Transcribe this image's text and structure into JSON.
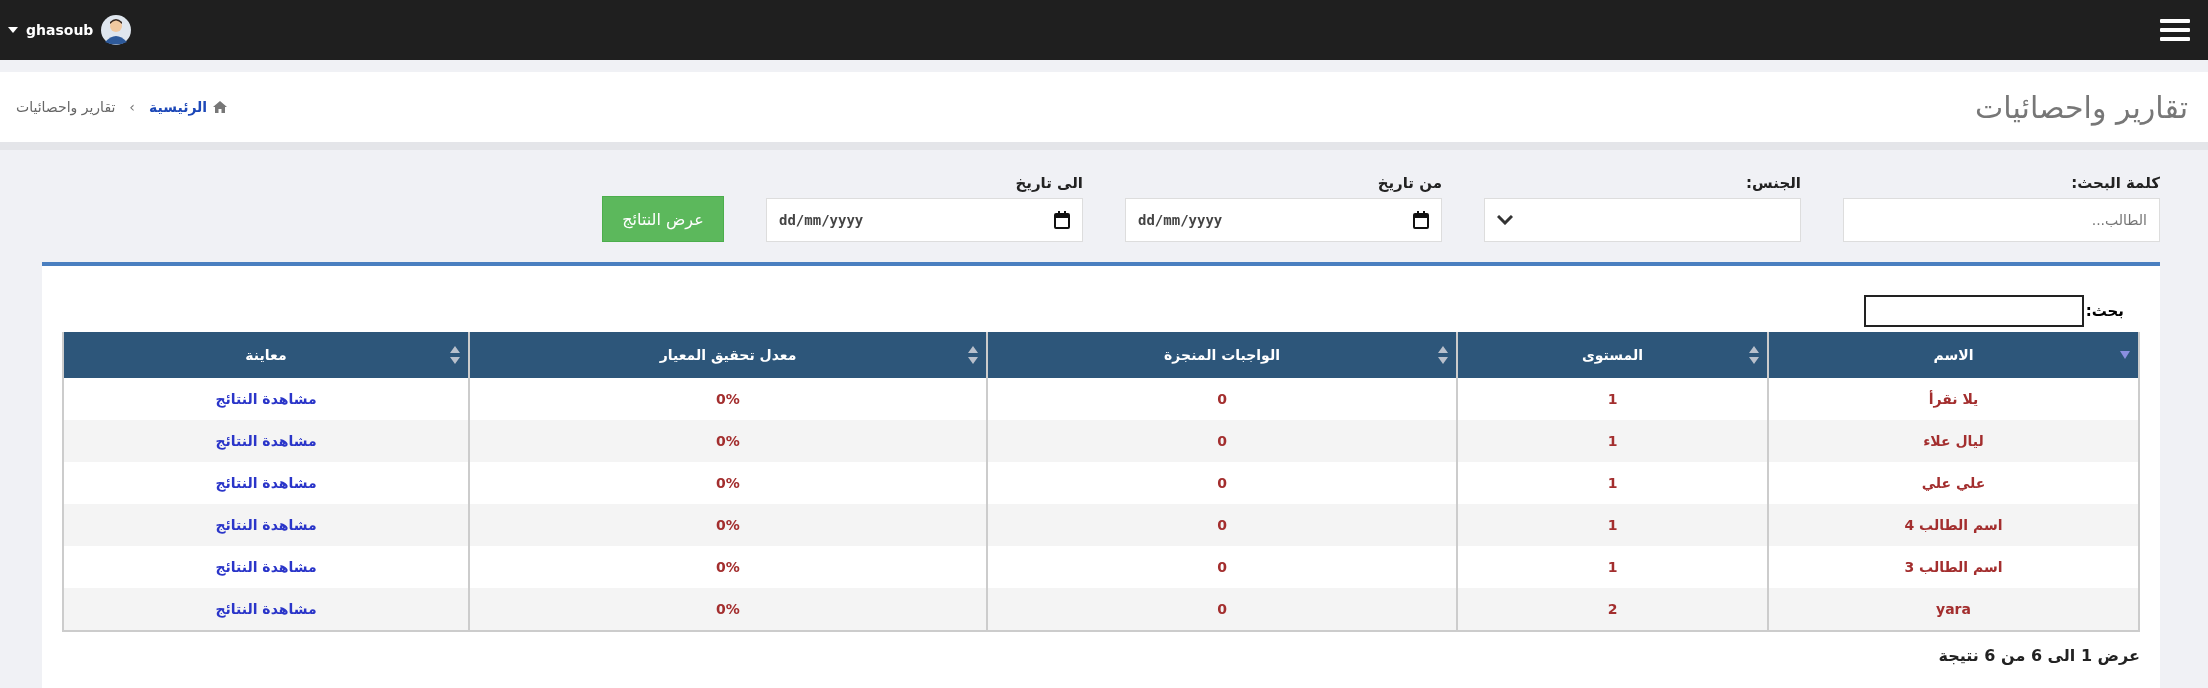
{
  "topbar": {
    "user": {
      "name": "ghasoub"
    }
  },
  "header": {
    "title": "تقارير واحصائيات",
    "breadcrumb": [
      {
        "label": "الرئيسية",
        "kind": "home"
      },
      {
        "label": "›",
        "kind": "separator"
      },
      {
        "label": "تقارير واحصائيات",
        "kind": "current"
      }
    ]
  },
  "filters": [
    {
      "kind": "text",
      "label": "كلمة البحث:",
      "placeholder": "الطالب..."
    },
    {
      "kind": "select",
      "label": "الجنس:"
    },
    {
      "kind": "date",
      "label": "من تاريخ",
      "value": "dd/mm/yyyy"
    },
    {
      "kind": "date",
      "label": "الى تاريخ",
      "value": "dd/mm/yyyy"
    }
  ],
  "submit_button": "عرض النتائج",
  "table_search": {
    "label": "بحث:"
  },
  "table": {
    "columns": [
      {
        "label": "الاسم",
        "sorted": true
      },
      {
        "label": "المستوى",
        "sorted": false
      },
      {
        "label": "الواجبات المنجزة",
        "sorted": false
      },
      {
        "label": "معدل تحقيق المعيار",
        "sorted": false
      },
      {
        "label": "معاينة",
        "sorted": false
      }
    ],
    "rows": [
      [
        "يلا نقرأ",
        "1",
        "0",
        "0%",
        "مشاهدة النتائج"
      ],
      [
        "ليال علاء",
        "1",
        "0",
        "0%",
        "مشاهدة النتائج"
      ],
      [
        "علي علي",
        "1",
        "0",
        "0%",
        "مشاهدة النتائج"
      ],
      [
        "اسم الطالب 4",
        "1",
        "0",
        "0%",
        "مشاهدة النتائج"
      ],
      [
        "اسم الطالب 3",
        "1",
        "0",
        "0%",
        "مشاهدة النتائج"
      ],
      [
        "yara",
        "2",
        "0",
        "0%",
        "مشاهدة النتائج"
      ]
    ]
  },
  "footer": "عرض 1 الى 6 من 6 نتيجة"
}
